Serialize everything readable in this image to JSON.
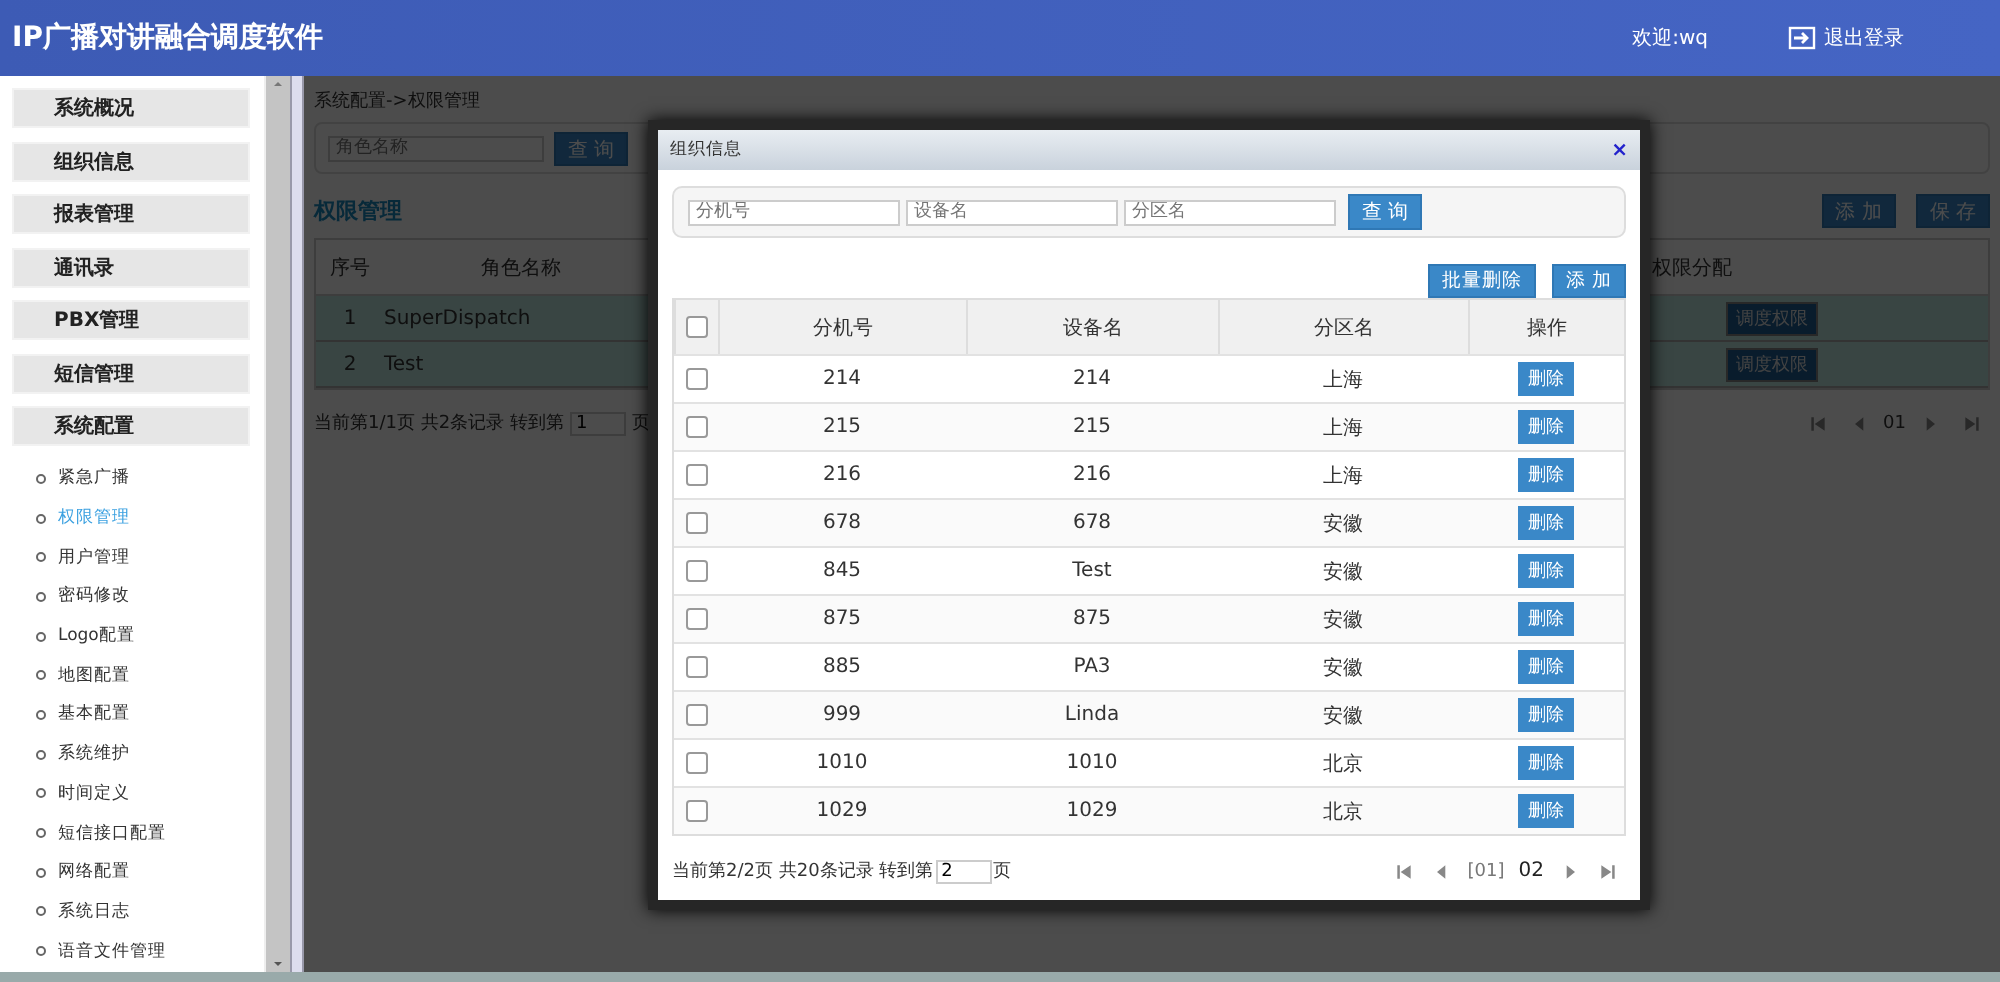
{
  "header": {
    "title": "IP广播对讲融合调度软件",
    "welcome": "欢迎:wq",
    "logout": "退出登录"
  },
  "sidebar": {
    "groups": [
      {
        "label": "系统概况"
      },
      {
        "label": "组织信息"
      },
      {
        "label": "报表管理"
      },
      {
        "label": "通讯录"
      },
      {
        "label": "PBX管理"
      },
      {
        "label": "短信管理"
      },
      {
        "label": "系统配置",
        "children": [
          {
            "label": "紧急广播",
            "selected": false
          },
          {
            "label": "权限管理",
            "selected": true
          },
          {
            "label": "用户管理",
            "selected": false
          },
          {
            "label": "密码修改",
            "selected": false
          },
          {
            "label": "Logo配置",
            "selected": false
          },
          {
            "label": "地图配置",
            "selected": false
          },
          {
            "label": "基本配置",
            "selected": false
          },
          {
            "label": "系统维护",
            "selected": false
          },
          {
            "label": "时间定义",
            "selected": false
          },
          {
            "label": "短信接口配置",
            "selected": false
          },
          {
            "label": "网络配置",
            "selected": false
          },
          {
            "label": "系统日志",
            "selected": false
          },
          {
            "label": "语音文件管理",
            "selected": false
          }
        ]
      }
    ]
  },
  "main": {
    "breadcrumb": "系统配置->权限管理",
    "search": {
      "placeholder": "角色名称",
      "button": "查 询"
    },
    "section_title": "权限管理",
    "actions": [
      "添 加",
      "保 存"
    ],
    "table": {
      "columns": [
        "序号",
        "角色名称",
        "权限分配"
      ],
      "rows": [
        {
          "index": "1",
          "name": "SuperDispatch",
          "button": "调度权限"
        },
        {
          "index": "2",
          "name": "Test",
          "button": "调度权限"
        }
      ]
    },
    "pagination": {
      "info": "当前第1/1页 共2条记录 转到第",
      "page_input": "1",
      "suffix": "页",
      "current": "01"
    }
  },
  "dialog": {
    "title": "组织信息",
    "close": "×",
    "filters": [
      {
        "placeholder": "分机号"
      },
      {
        "placeholder": "设备名"
      },
      {
        "placeholder": "分区名"
      }
    ],
    "search_button": "查 询",
    "toolbar": [
      "批量删除",
      "添 加"
    ],
    "table": {
      "all_checked": false,
      "columns": [
        "分机号",
        "设备名",
        "分区名",
        "操作"
      ],
      "rows": [
        {
          "checked": false,
          "ext": "214",
          "device": "214",
          "zone": "上海",
          "action": "删除"
        },
        {
          "checked": false,
          "ext": "215",
          "device": "215",
          "zone": "上海",
          "action": "删除"
        },
        {
          "checked": false,
          "ext": "216",
          "device": "216",
          "zone": "上海",
          "action": "删除"
        },
        {
          "checked": false,
          "ext": "678",
          "device": "678",
          "zone": "安徽",
          "action": "删除"
        },
        {
          "checked": false,
          "ext": "845",
          "device": "Test",
          "zone": "安徽",
          "action": "删除"
        },
        {
          "checked": false,
          "ext": "875",
          "device": "875",
          "zone": "安徽",
          "action": "删除"
        },
        {
          "checked": false,
          "ext": "885",
          "device": "PA3",
          "zone": "安徽",
          "action": "删除"
        },
        {
          "checked": false,
          "ext": "999",
          "device": "Linda",
          "zone": "安徽",
          "action": "删除"
        },
        {
          "checked": false,
          "ext": "1010",
          "device": "1010",
          "zone": "北京",
          "action": "删除"
        },
        {
          "checked": false,
          "ext": "1029",
          "device": "1029",
          "zone": "北京",
          "action": "删除"
        }
      ]
    },
    "pagination": {
      "info": "当前第2/2页 共20条记录 转到第",
      "page_input": "2",
      "suffix": "页",
      "pages": [
        {
          "label": "[01]",
          "selected": false
        },
        {
          "label": "02",
          "selected": true
        }
      ]
    }
  }
}
